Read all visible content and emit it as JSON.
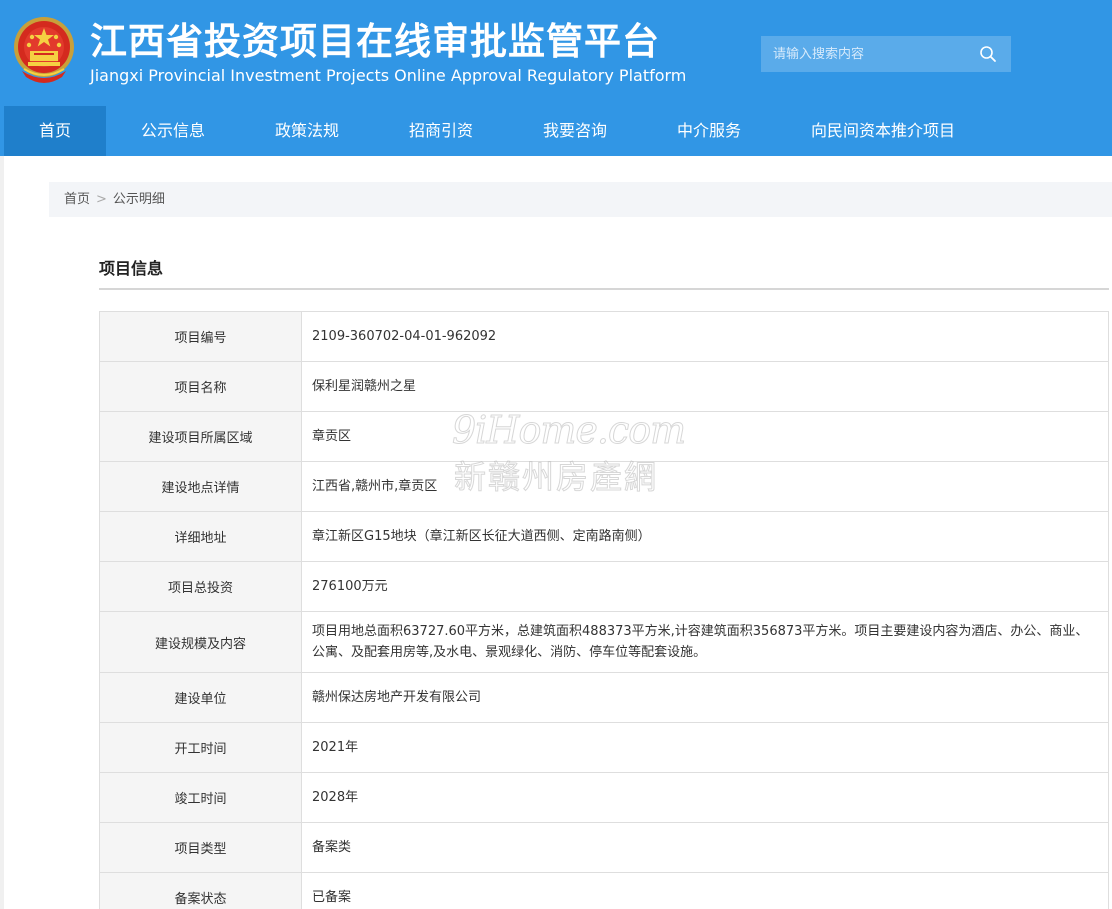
{
  "header": {
    "title_cn": "江西省投资项目在线审批监管平台",
    "title_en": "Jiangxi Provincial Investment Projects Online Approval Regulatory Platform",
    "emblem_icon": "national-emblem-icon",
    "search": {
      "placeholder": "请输入搜索内容",
      "icon": "search-icon"
    }
  },
  "nav": {
    "items": [
      {
        "label": "首页"
      },
      {
        "label": "公示信息"
      },
      {
        "label": "政策法规"
      },
      {
        "label": "招商引资"
      },
      {
        "label": "我要咨询"
      },
      {
        "label": "中介服务"
      },
      {
        "label": "向民间资本推介项目"
      }
    ]
  },
  "breadcrumb": {
    "home": "首页",
    "separator": ">",
    "current": "公示明细"
  },
  "section": {
    "title": "项目信息"
  },
  "info_table": {
    "rows": [
      {
        "label": "项目编号",
        "value": "2109-360702-04-01-962092"
      },
      {
        "label": "项目名称",
        "value": "保利星润赣州之星"
      },
      {
        "label": "建设项目所属区域",
        "value": "章贡区"
      },
      {
        "label": "建设地点详情",
        "value": "江西省,赣州市,章贡区"
      },
      {
        "label": "详细地址",
        "value": "章江新区G15地块（章江新区长征大道西侧、定南路南侧）"
      },
      {
        "label": "项目总投资",
        "value": "276100万元"
      },
      {
        "label": "建设规模及内容",
        "value": "项目用地总面积63727.60平方米，总建筑面积488373平方米,计容建筑面积356873平方米。项目主要建设内容为酒店、办公、商业、公寓、及配套用房等,及水电、景观绿化、消防、停车位等配套设施。"
      },
      {
        "label": "建设单位",
        "value": "赣州保达房地产开发有限公司"
      },
      {
        "label": "开工时间",
        "value": "2021年"
      },
      {
        "label": "竣工时间",
        "value": "2028年"
      },
      {
        "label": "项目类型",
        "value": "备案类"
      },
      {
        "label": "备案状态",
        "value": "已备案"
      }
    ]
  },
  "watermark": {
    "top": "9iHome.com",
    "bottom": "新赣州房產網"
  },
  "colors": {
    "header_bg": "#3196e5",
    "nav_active": "#1f7fcb",
    "label_bg": "#f5f5f5",
    "border": "#dedede"
  }
}
